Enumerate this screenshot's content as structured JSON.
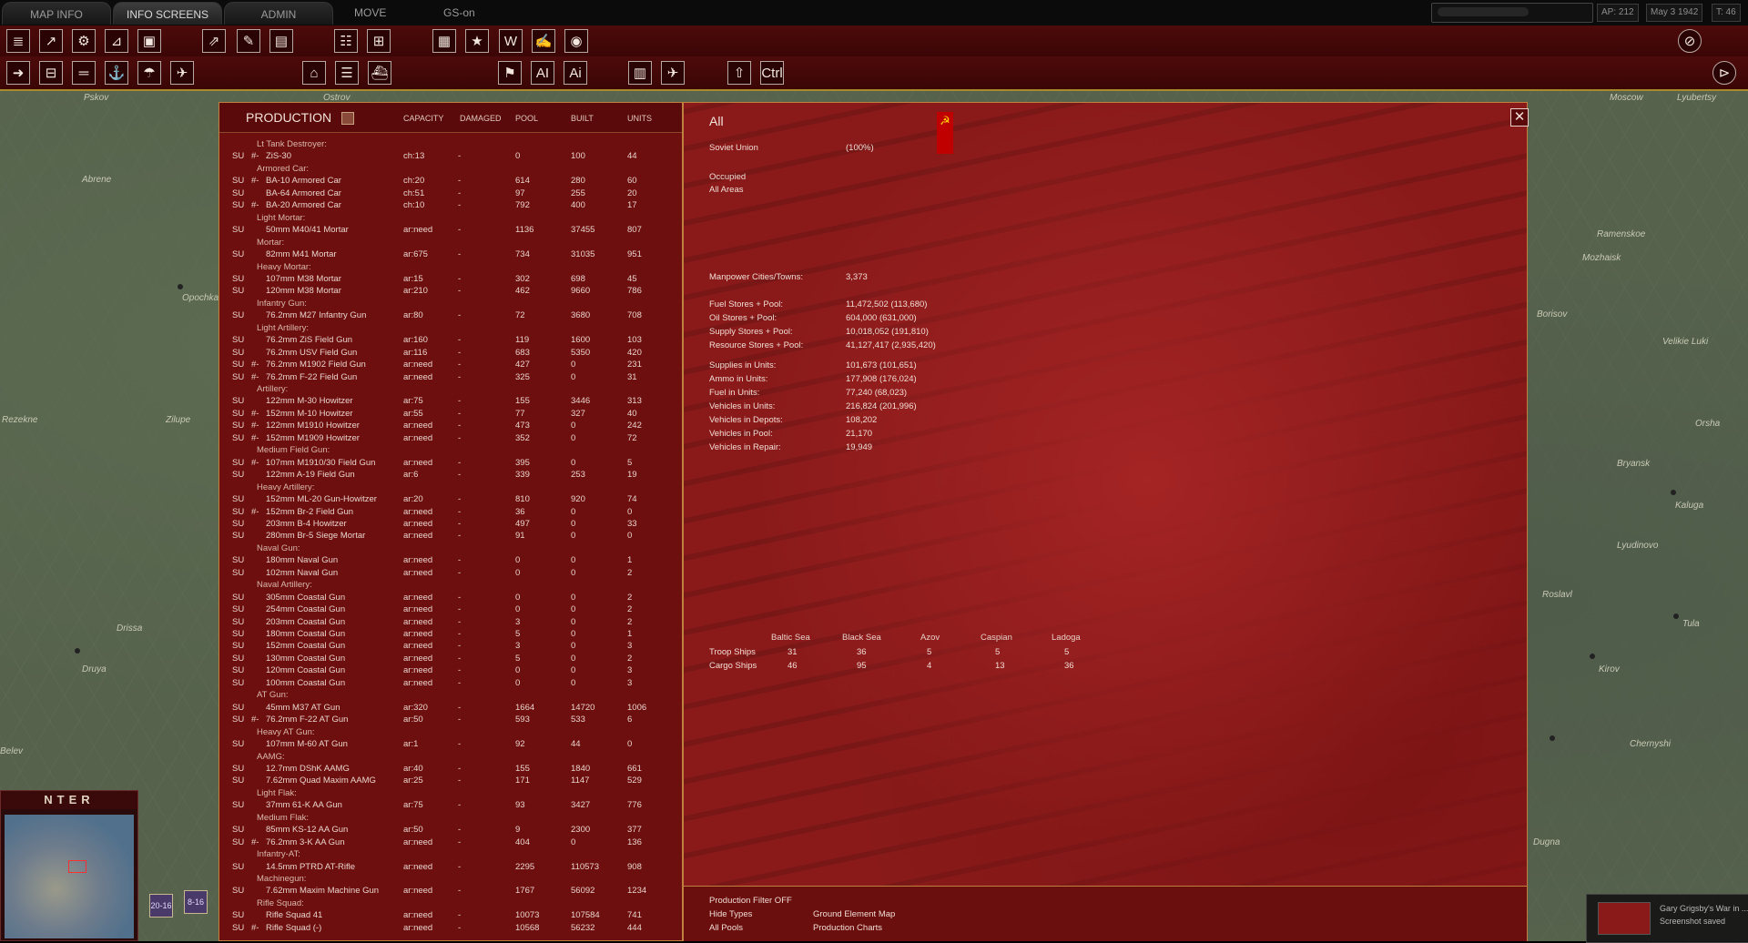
{
  "top_tabs": {
    "map_info": "MAP INFO",
    "info_screens": "INFO SCREENS",
    "admin": "ADMIN",
    "move": "MOVE",
    "gs_on": "GS-on"
  },
  "status": {
    "ap": "AP: 212",
    "date": "May 3 1942",
    "turn": "T: 46"
  },
  "map_labels": [
    "Abrene",
    "Pskov",
    "Ostrov",
    "Opochka",
    "Rezekne",
    "Zilupe",
    "Drissa",
    "Druya",
    "Moscow",
    "Lyubertsy",
    "Ramenskoe",
    "Mozhaisk",
    "Velikie Luki",
    "Borisov",
    "Orsha",
    "Bryansk",
    "Kaluga",
    "Lyudinovo",
    "Tula",
    "Kirov",
    "Belev",
    "Chernyshi",
    "Dugna",
    "Roslavl"
  ],
  "minimap": {
    "title": "NTER"
  },
  "counters": [
    "20-16",
    "8-16"
  ],
  "production": {
    "title": "PRODUCTION",
    "headers": {
      "capacity": "CAPACITY",
      "damaged": "DAMAGED",
      "pool": "POOL",
      "built": "BUILT",
      "units": "UNITS"
    },
    "rows": [
      {
        "type": "group",
        "name": "Lt Tank Destroyer:"
      },
      {
        "type": "item",
        "nat": "SU",
        "prefix": "#-",
        "name": "ZiS-30",
        "cap": "ch:13",
        "dmg": "-",
        "pool": "0",
        "built": "100",
        "units": "44"
      },
      {
        "type": "group",
        "name": "Armored Car:"
      },
      {
        "type": "item",
        "nat": "SU",
        "prefix": "#-",
        "name": "BA-10 Armored Car",
        "cap": "ch:20",
        "dmg": "-",
        "pool": "614",
        "built": "280",
        "units": "60"
      },
      {
        "type": "item",
        "nat": "SU",
        "prefix": "",
        "name": "BA-64 Armored Car",
        "cap": "ch:51",
        "dmg": "-",
        "pool": "97",
        "built": "255",
        "units": "20"
      },
      {
        "type": "item",
        "nat": "SU",
        "prefix": "#-",
        "name": "BA-20 Armored Car",
        "cap": "ch:10",
        "dmg": "-",
        "pool": "792",
        "built": "400",
        "units": "17"
      },
      {
        "type": "group",
        "name": "Light Mortar:"
      },
      {
        "type": "item",
        "nat": "SU",
        "prefix": "",
        "name": "50mm M40/41 Mortar",
        "cap": "ar:need",
        "dmg": "-",
        "pool": "1136",
        "built": "37455",
        "units": "807"
      },
      {
        "type": "group",
        "name": "Mortar:"
      },
      {
        "type": "item",
        "nat": "SU",
        "prefix": "",
        "name": "82mm M41 Mortar",
        "cap": "ar:675",
        "dmg": "-",
        "pool": "734",
        "built": "31035",
        "units": "951"
      },
      {
        "type": "group",
        "name": "Heavy Mortar:"
      },
      {
        "type": "item",
        "nat": "SU",
        "prefix": "",
        "name": "107mm M38 Mortar",
        "cap": "ar:15",
        "dmg": "-",
        "pool": "302",
        "built": "698",
        "units": "45"
      },
      {
        "type": "item",
        "nat": "SU",
        "prefix": "",
        "name": "120mm M38 Mortar",
        "cap": "ar:210",
        "dmg": "-",
        "pool": "462",
        "built": "9660",
        "units": "786"
      },
      {
        "type": "group",
        "name": "Infantry Gun:"
      },
      {
        "type": "item",
        "nat": "SU",
        "prefix": "",
        "name": "76.2mm M27 Infantry Gun",
        "cap": "ar:80",
        "dmg": "-",
        "pool": "72",
        "built": "3680",
        "units": "708"
      },
      {
        "type": "group",
        "name": "Light Artillery:"
      },
      {
        "type": "item",
        "nat": "SU",
        "prefix": "",
        "name": "76.2mm ZiS Field Gun",
        "cap": "ar:160",
        "dmg": "-",
        "pool": "119",
        "built": "1600",
        "units": "103"
      },
      {
        "type": "item",
        "nat": "SU",
        "prefix": "",
        "name": "76.2mm USV Field Gun",
        "cap": "ar:116",
        "dmg": "-",
        "pool": "683",
        "built": "5350",
        "units": "420"
      },
      {
        "type": "item",
        "nat": "SU",
        "prefix": "#-",
        "name": "76.2mm M1902 Field Gun",
        "cap": "ar:need",
        "dmg": "-",
        "pool": "427",
        "built": "0",
        "units": "231"
      },
      {
        "type": "item",
        "nat": "SU",
        "prefix": "#-",
        "name": "76.2mm F-22 Field Gun",
        "cap": "ar:need",
        "dmg": "-",
        "pool": "325",
        "built": "0",
        "units": "31"
      },
      {
        "type": "group",
        "name": "Artillery:"
      },
      {
        "type": "item",
        "nat": "SU",
        "prefix": "",
        "name": "122mm M-30 Howitzer",
        "cap": "ar:75",
        "dmg": "-",
        "pool": "155",
        "built": "3446",
        "units": "313"
      },
      {
        "type": "item",
        "nat": "SU",
        "prefix": "#-",
        "name": "152mm M-10 Howitzer",
        "cap": "ar:55",
        "dmg": "-",
        "pool": "77",
        "built": "327",
        "units": "40"
      },
      {
        "type": "item",
        "nat": "SU",
        "prefix": "#-",
        "name": "122mm M1910 Howitzer",
        "cap": "ar:need",
        "dmg": "-",
        "pool": "473",
        "built": "0",
        "units": "242"
      },
      {
        "type": "item",
        "nat": "SU",
        "prefix": "#-",
        "name": "152mm M1909 Howitzer",
        "cap": "ar:need",
        "dmg": "-",
        "pool": "352",
        "built": "0",
        "units": "72"
      },
      {
        "type": "group",
        "name": "Medium Field Gun:"
      },
      {
        "type": "item",
        "nat": "SU",
        "prefix": "#-",
        "name": "107mm M1910/30 Field Gun",
        "cap": "ar:need",
        "dmg": "-",
        "pool": "395",
        "built": "0",
        "units": "5"
      },
      {
        "type": "item",
        "nat": "SU",
        "prefix": "",
        "name": "122mm A-19 Field Gun",
        "cap": "ar:6",
        "dmg": "-",
        "pool": "339",
        "built": "253",
        "units": "19"
      },
      {
        "type": "group",
        "name": "Heavy Artillery:"
      },
      {
        "type": "item",
        "nat": "SU",
        "prefix": "",
        "name": "152mm ML-20 Gun-Howitzer",
        "cap": "ar:20",
        "dmg": "-",
        "pool": "810",
        "built": "920",
        "units": "74"
      },
      {
        "type": "item",
        "nat": "SU",
        "prefix": "#-",
        "name": "152mm Br-2 Field Gun",
        "cap": "ar:need",
        "dmg": "-",
        "pool": "36",
        "built": "0",
        "units": "0"
      },
      {
        "type": "item",
        "nat": "SU",
        "prefix": "",
        "name": "203mm B-4 Howitzer",
        "cap": "ar:need",
        "dmg": "-",
        "pool": "497",
        "built": "0",
        "units": "33"
      },
      {
        "type": "item",
        "nat": "SU",
        "prefix": "",
        "name": "280mm Br-5 Siege Mortar",
        "cap": "ar:need",
        "dmg": "-",
        "pool": "91",
        "built": "0",
        "units": "0"
      },
      {
        "type": "group",
        "name": "Naval Gun:"
      },
      {
        "type": "item",
        "nat": "SU",
        "prefix": "",
        "name": "180mm Naval Gun",
        "cap": "ar:need",
        "dmg": "-",
        "pool": "0",
        "built": "0",
        "units": "1"
      },
      {
        "type": "item",
        "nat": "SU",
        "prefix": "",
        "name": "102mm Naval Gun",
        "cap": "ar:need",
        "dmg": "-",
        "pool": "0",
        "built": "0",
        "units": "2"
      },
      {
        "type": "group",
        "name": "Naval Artillery:"
      },
      {
        "type": "item",
        "nat": "SU",
        "prefix": "",
        "name": "305mm Coastal Gun",
        "cap": "ar:need",
        "dmg": "-",
        "pool": "0",
        "built": "0",
        "units": "2"
      },
      {
        "type": "item",
        "nat": "SU",
        "prefix": "",
        "name": "254mm Coastal Gun",
        "cap": "ar:need",
        "dmg": "-",
        "pool": "0",
        "built": "0",
        "units": "2"
      },
      {
        "type": "item",
        "nat": "SU",
        "prefix": "",
        "name": "203mm Coastal Gun",
        "cap": "ar:need",
        "dmg": "-",
        "pool": "3",
        "built": "0",
        "units": "2"
      },
      {
        "type": "item",
        "nat": "SU",
        "prefix": "",
        "name": "180mm Coastal Gun",
        "cap": "ar:need",
        "dmg": "-",
        "pool": "5",
        "built": "0",
        "units": "1"
      },
      {
        "type": "item",
        "nat": "SU",
        "prefix": "",
        "name": "152mm Coastal Gun",
        "cap": "ar:need",
        "dmg": "-",
        "pool": "3",
        "built": "0",
        "units": "3"
      },
      {
        "type": "item",
        "nat": "SU",
        "prefix": "",
        "name": "130mm Coastal Gun",
        "cap": "ar:need",
        "dmg": "-",
        "pool": "5",
        "built": "0",
        "units": "2"
      },
      {
        "type": "item",
        "nat": "SU",
        "prefix": "",
        "name": "120mm Coastal Gun",
        "cap": "ar:need",
        "dmg": "-",
        "pool": "0",
        "built": "0",
        "units": "3"
      },
      {
        "type": "item",
        "nat": "SU",
        "prefix": "",
        "name": "100mm Coastal Gun",
        "cap": "ar:need",
        "dmg": "-",
        "pool": "0",
        "built": "0",
        "units": "3"
      },
      {
        "type": "group",
        "name": "AT Gun:"
      },
      {
        "type": "item",
        "nat": "SU",
        "prefix": "",
        "name": "45mm M37 AT Gun",
        "cap": "ar:320",
        "dmg": "-",
        "pool": "1664",
        "built": "14720",
        "units": "1006"
      },
      {
        "type": "item",
        "nat": "SU",
        "prefix": "#-",
        "name": "76.2mm F-22 AT Gun",
        "cap": "ar:50",
        "dmg": "-",
        "pool": "593",
        "built": "533",
        "units": "6"
      },
      {
        "type": "group",
        "name": "Heavy AT Gun:"
      },
      {
        "type": "item",
        "nat": "SU",
        "prefix": "",
        "name": "107mm M-60 AT Gun",
        "cap": "ar:1",
        "dmg": "-",
        "pool": "92",
        "built": "44",
        "units": "0"
      },
      {
        "type": "group",
        "name": "AAMG:"
      },
      {
        "type": "item",
        "nat": "SU",
        "prefix": "",
        "name": "12.7mm DShK AAMG",
        "cap": "ar:40",
        "dmg": "-",
        "pool": "155",
        "built": "1840",
        "units": "661"
      },
      {
        "type": "item",
        "nat": "SU",
        "prefix": "",
        "name": "7.62mm Quad Maxim AAMG",
        "cap": "ar:25",
        "dmg": "-",
        "pool": "171",
        "built": "1147",
        "units": "529"
      },
      {
        "type": "group",
        "name": "Light Flak:"
      },
      {
        "type": "item",
        "nat": "SU",
        "prefix": "",
        "name": "37mm 61-K AA Gun",
        "cap": "ar:75",
        "dmg": "-",
        "pool": "93",
        "built": "3427",
        "units": "776"
      },
      {
        "type": "group",
        "name": "Medium Flak:"
      },
      {
        "type": "item",
        "nat": "SU",
        "prefix": "",
        "name": "85mm KS-12 AA Gun",
        "cap": "ar:50",
        "dmg": "-",
        "pool": "9",
        "built": "2300",
        "units": "377"
      },
      {
        "type": "item",
        "nat": "SU",
        "prefix": "#-",
        "name": "76.2mm 3-K AA Gun",
        "cap": "ar:need",
        "dmg": "-",
        "pool": "404",
        "built": "0",
        "units": "136"
      },
      {
        "type": "group",
        "name": "Infantry-AT:"
      },
      {
        "type": "item",
        "nat": "SU",
        "prefix": "",
        "name": "14.5mm PTRD AT-Rifle",
        "cap": "ar:need",
        "dmg": "-",
        "pool": "2295",
        "built": "110573",
        "units": "908"
      },
      {
        "type": "group",
        "name": "Machinegun:"
      },
      {
        "type": "item",
        "nat": "SU",
        "prefix": "",
        "name": "7.62mm Maxim Machine Gun",
        "cap": "ar:need",
        "dmg": "-",
        "pool": "1767",
        "built": "56092",
        "units": "1234"
      },
      {
        "type": "group",
        "name": "Rifle Squad:"
      },
      {
        "type": "item",
        "nat": "SU",
        "prefix": "",
        "name": "Rifle Squad 41",
        "cap": "ar:need",
        "dmg": "-",
        "pool": "10073",
        "built": "107584",
        "units": "741"
      },
      {
        "type": "item",
        "nat": "SU",
        "prefix": "#-",
        "name": "Rifle Squad (-)",
        "cap": "ar:need",
        "dmg": "-",
        "pool": "10568",
        "built": "56232",
        "units": "444"
      }
    ]
  },
  "info": {
    "title": "All",
    "nation": "Soviet Union",
    "nation_pct": "(100%)",
    "occupied": "Occupied",
    "all_areas": "All Areas",
    "stats": [
      {
        "label": "Manpower Cities/Towns:",
        "value": "3,373"
      },
      {
        "label": "Fuel Stores + Pool:",
        "value": "11,472,502 (113,680)"
      },
      {
        "label": "Oil Stores + Pool:",
        "value": "604,000 (631,000)"
      },
      {
        "label": "Supply Stores + Pool:",
        "value": "10,018,052 (191,810)"
      },
      {
        "label": "Resource Stores + Pool:",
        "value": "41,127,417 (2,935,420)"
      },
      {
        "label": "Supplies in Units:",
        "value": "101,673 (101,651)"
      },
      {
        "label": "Ammo in Units:",
        "value": "177,908 (176,024)"
      },
      {
        "label": "Fuel in Units:",
        "value": "77,240 (68,023)"
      },
      {
        "label": "Vehicles in Units:",
        "value": "216,824 (201,996)"
      },
      {
        "label": "Vehicles in Depots:",
        "value": "108,202"
      },
      {
        "label": "Vehicles in Pool:",
        "value": "21,170"
      },
      {
        "label": "Vehicles in Repair:",
        "value": "19,949"
      }
    ],
    "ships": {
      "headers": [
        "Baltic Sea",
        "Black Sea",
        "Azov",
        "Caspian",
        "Ladoga"
      ],
      "rows": [
        {
          "label": "Troop Ships",
          "values": [
            "31",
            "36",
            "5",
            "5",
            "5"
          ]
        },
        {
          "label": "Cargo Ships",
          "values": [
            "46",
            "95",
            "4",
            "13",
            "36"
          ]
        }
      ]
    },
    "footer": {
      "filter": "Production Filter OFF",
      "hide_types": "Hide Types",
      "all_pools": "All Pools",
      "ground_map": "Ground Element Map",
      "charts": "Production Charts"
    }
  },
  "notification": {
    "line1": "Gary Grigsby's War in ...",
    "line2": "Screenshot saved"
  },
  "colors": {
    "panel_red": "#6e0f0f",
    "accent_gold": "#c08040",
    "flag_red": "#c00000"
  },
  "icons": {
    "toolbar1": [
      "report-icon",
      "chart-up-icon",
      "gear-icon",
      "graph-icon",
      "camera-icon",
      "arrow-up-right-icon",
      "edit-icon",
      "document-icon",
      "unit-list-icon",
      "formation-icon",
      "grid-icon",
      "star-icon",
      "w-icon",
      "signature-icon",
      "photo-icon"
    ],
    "toolbar2": [
      "arrow-right-icon",
      "train-icon",
      "rail-icon",
      "naval-icon",
      "airborne-icon",
      "air-icon",
      "hq-icon",
      "list-icon",
      "ship-icon",
      "flag-icon",
      "ai-icon",
      "ai-alt-icon",
      "building-icon",
      "plane-icon",
      "up-icon",
      "ctrl-icon"
    ]
  }
}
